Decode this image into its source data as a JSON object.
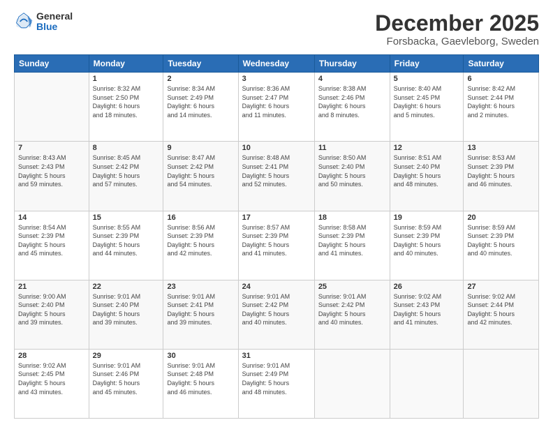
{
  "logo": {
    "general": "General",
    "blue": "Blue"
  },
  "header": {
    "month": "December 2025",
    "location": "Forsbacka, Gaevleborg, Sweden"
  },
  "weekdays": [
    "Sunday",
    "Monday",
    "Tuesday",
    "Wednesday",
    "Thursday",
    "Friday",
    "Saturday"
  ],
  "weeks": [
    [
      {
        "day": "",
        "info": ""
      },
      {
        "day": "1",
        "info": "Sunrise: 8:32 AM\nSunset: 2:50 PM\nDaylight: 6 hours\nand 18 minutes."
      },
      {
        "day": "2",
        "info": "Sunrise: 8:34 AM\nSunset: 2:49 PM\nDaylight: 6 hours\nand 14 minutes."
      },
      {
        "day": "3",
        "info": "Sunrise: 8:36 AM\nSunset: 2:47 PM\nDaylight: 6 hours\nand 11 minutes."
      },
      {
        "day": "4",
        "info": "Sunrise: 8:38 AM\nSunset: 2:46 PM\nDaylight: 6 hours\nand 8 minutes."
      },
      {
        "day": "5",
        "info": "Sunrise: 8:40 AM\nSunset: 2:45 PM\nDaylight: 6 hours\nand 5 minutes."
      },
      {
        "day": "6",
        "info": "Sunrise: 8:42 AM\nSunset: 2:44 PM\nDaylight: 6 hours\nand 2 minutes."
      }
    ],
    [
      {
        "day": "7",
        "info": "Sunrise: 8:43 AM\nSunset: 2:43 PM\nDaylight: 5 hours\nand 59 minutes."
      },
      {
        "day": "8",
        "info": "Sunrise: 8:45 AM\nSunset: 2:42 PM\nDaylight: 5 hours\nand 57 minutes."
      },
      {
        "day": "9",
        "info": "Sunrise: 8:47 AM\nSunset: 2:42 PM\nDaylight: 5 hours\nand 54 minutes."
      },
      {
        "day": "10",
        "info": "Sunrise: 8:48 AM\nSunset: 2:41 PM\nDaylight: 5 hours\nand 52 minutes."
      },
      {
        "day": "11",
        "info": "Sunrise: 8:50 AM\nSunset: 2:40 PM\nDaylight: 5 hours\nand 50 minutes."
      },
      {
        "day": "12",
        "info": "Sunrise: 8:51 AM\nSunset: 2:40 PM\nDaylight: 5 hours\nand 48 minutes."
      },
      {
        "day": "13",
        "info": "Sunrise: 8:53 AM\nSunset: 2:39 PM\nDaylight: 5 hours\nand 46 minutes."
      }
    ],
    [
      {
        "day": "14",
        "info": "Sunrise: 8:54 AM\nSunset: 2:39 PM\nDaylight: 5 hours\nand 45 minutes."
      },
      {
        "day": "15",
        "info": "Sunrise: 8:55 AM\nSunset: 2:39 PM\nDaylight: 5 hours\nand 44 minutes."
      },
      {
        "day": "16",
        "info": "Sunrise: 8:56 AM\nSunset: 2:39 PM\nDaylight: 5 hours\nand 42 minutes."
      },
      {
        "day": "17",
        "info": "Sunrise: 8:57 AM\nSunset: 2:39 PM\nDaylight: 5 hours\nand 41 minutes."
      },
      {
        "day": "18",
        "info": "Sunrise: 8:58 AM\nSunset: 2:39 PM\nDaylight: 5 hours\nand 41 minutes."
      },
      {
        "day": "19",
        "info": "Sunrise: 8:59 AM\nSunset: 2:39 PM\nDaylight: 5 hours\nand 40 minutes."
      },
      {
        "day": "20",
        "info": "Sunrise: 8:59 AM\nSunset: 2:39 PM\nDaylight: 5 hours\nand 40 minutes."
      }
    ],
    [
      {
        "day": "21",
        "info": "Sunrise: 9:00 AM\nSunset: 2:40 PM\nDaylight: 5 hours\nand 39 minutes."
      },
      {
        "day": "22",
        "info": "Sunrise: 9:01 AM\nSunset: 2:40 PM\nDaylight: 5 hours\nand 39 minutes."
      },
      {
        "day": "23",
        "info": "Sunrise: 9:01 AM\nSunset: 2:41 PM\nDaylight: 5 hours\nand 39 minutes."
      },
      {
        "day": "24",
        "info": "Sunrise: 9:01 AM\nSunset: 2:42 PM\nDaylight: 5 hours\nand 40 minutes."
      },
      {
        "day": "25",
        "info": "Sunrise: 9:01 AM\nSunset: 2:42 PM\nDaylight: 5 hours\nand 40 minutes."
      },
      {
        "day": "26",
        "info": "Sunrise: 9:02 AM\nSunset: 2:43 PM\nDaylight: 5 hours\nand 41 minutes."
      },
      {
        "day": "27",
        "info": "Sunrise: 9:02 AM\nSunset: 2:44 PM\nDaylight: 5 hours\nand 42 minutes."
      }
    ],
    [
      {
        "day": "28",
        "info": "Sunrise: 9:02 AM\nSunset: 2:45 PM\nDaylight: 5 hours\nand 43 minutes."
      },
      {
        "day": "29",
        "info": "Sunrise: 9:01 AM\nSunset: 2:46 PM\nDaylight: 5 hours\nand 45 minutes."
      },
      {
        "day": "30",
        "info": "Sunrise: 9:01 AM\nSunset: 2:48 PM\nDaylight: 5 hours\nand 46 minutes."
      },
      {
        "day": "31",
        "info": "Sunrise: 9:01 AM\nSunset: 2:49 PM\nDaylight: 5 hours\nand 48 minutes."
      },
      {
        "day": "",
        "info": ""
      },
      {
        "day": "",
        "info": ""
      },
      {
        "day": "",
        "info": ""
      }
    ]
  ]
}
